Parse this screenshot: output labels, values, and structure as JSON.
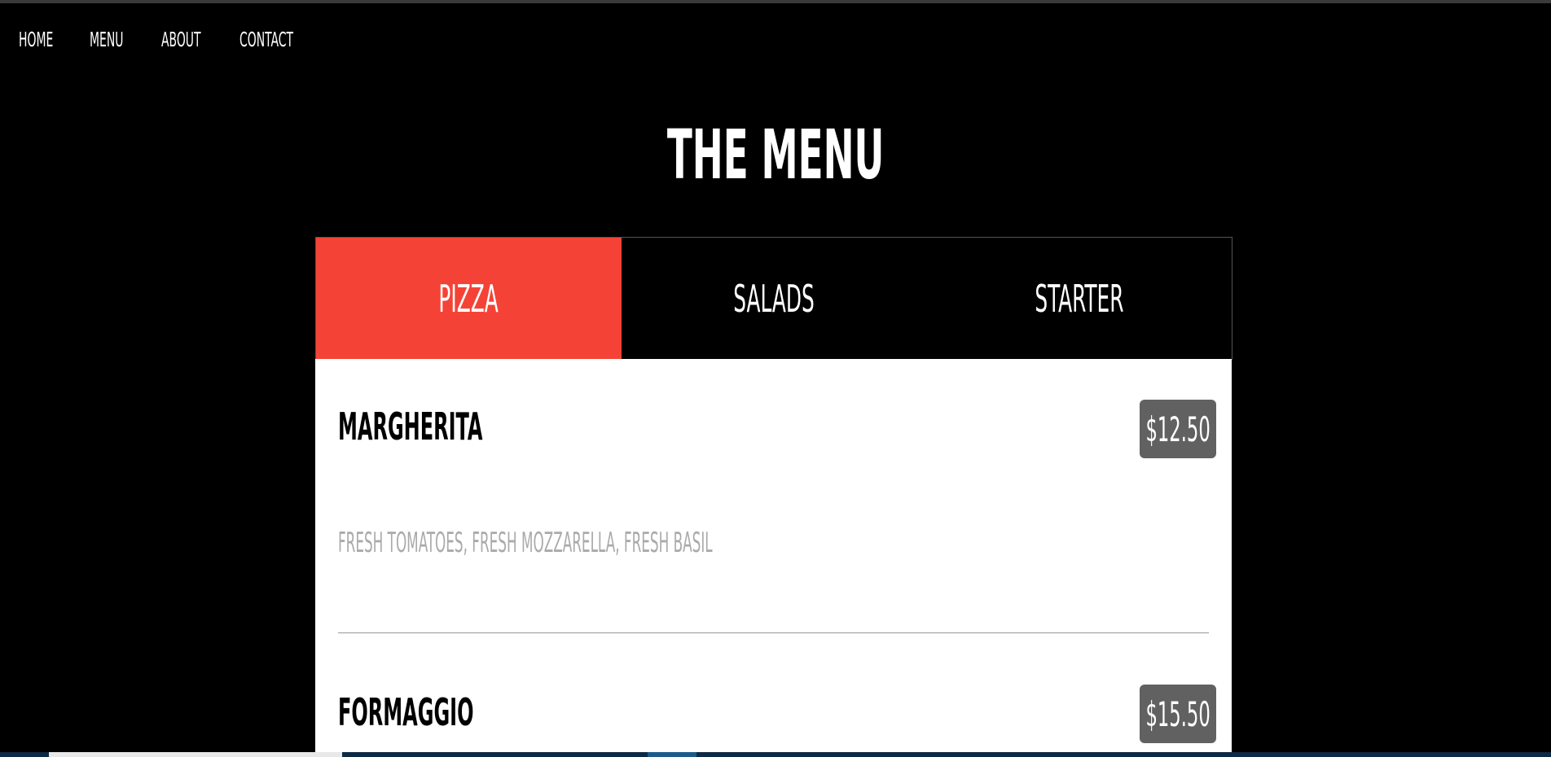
{
  "nav": {
    "items": [
      {
        "label": "HOME"
      },
      {
        "label": "MENU"
      },
      {
        "label": "ABOUT"
      },
      {
        "label": "CONTACT"
      }
    ]
  },
  "page": {
    "title": "THE MENU"
  },
  "tabs": [
    {
      "label": "PIZZA",
      "active": true
    },
    {
      "label": "SALADS",
      "active": false
    },
    {
      "label": "STARTER",
      "active": false
    }
  ],
  "menu_items": [
    {
      "name": "MARGHERITA",
      "price": "$12.50",
      "description": "FRESH TOMATOES, FRESH MOZZARELLA, FRESH BASIL"
    },
    {
      "name": "FORMAGGIO",
      "price": "$15.50"
    }
  ],
  "colors": {
    "accent": "#f44336",
    "background": "#000000",
    "price_badge": "#616161"
  }
}
